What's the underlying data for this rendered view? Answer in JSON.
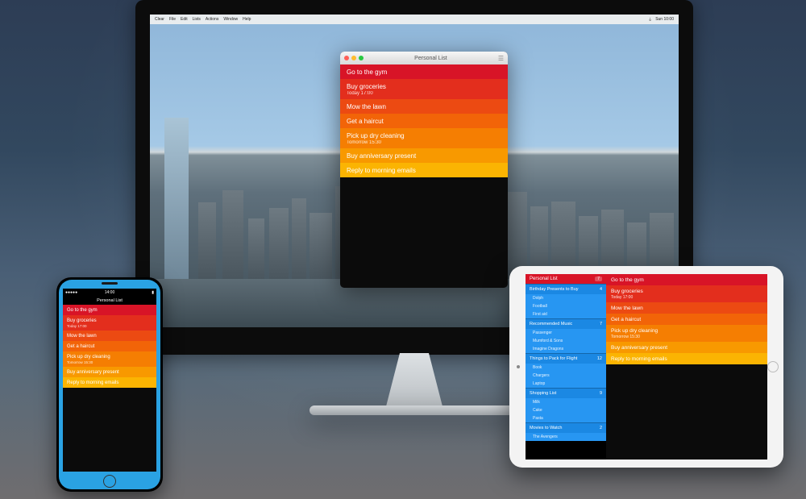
{
  "menubar": {
    "items": [
      "Clear",
      "File",
      "Edit",
      "Lists",
      "Actions",
      "Window",
      "Help"
    ],
    "clock": "Sun 10:00"
  },
  "mac_window": {
    "title": "Personal List"
  },
  "tasks": [
    {
      "title": "Go to the gym",
      "sub": ""
    },
    {
      "title": "Buy groceries",
      "sub": "Today 17:00"
    },
    {
      "title": "Mow the lawn",
      "sub": ""
    },
    {
      "title": "Get a haircut",
      "sub": ""
    },
    {
      "title": "Pick up dry cleaning",
      "sub": "Tomorrow 15:30"
    },
    {
      "title": "Buy anniversary present",
      "sub": ""
    },
    {
      "title": "Reply to morning emails",
      "sub": ""
    }
  ],
  "iphone": {
    "status_left": "●●●●●",
    "status_time": "14:00",
    "status_right": "▮",
    "header": "Personal List"
  },
  "ipad": {
    "sidebar": [
      {
        "type": "head",
        "label": "Personal List",
        "count": "7"
      },
      {
        "type": "item",
        "label": "Birthday Presents to Buy",
        "count": "4"
      },
      {
        "type": "sub",
        "label": "Dolph"
      },
      {
        "type": "sub",
        "label": "Football"
      },
      {
        "type": "sub",
        "label": "First aid"
      },
      {
        "type": "item",
        "label": "Recommended Music",
        "count": "7"
      },
      {
        "type": "sub",
        "label": "Passenger"
      },
      {
        "type": "sub",
        "label": "Mumford & Sons"
      },
      {
        "type": "sub",
        "label": "Imagine Dragons"
      },
      {
        "type": "item",
        "label": "Things to Pack for Flight",
        "count": "12"
      },
      {
        "type": "sub",
        "label": "Book"
      },
      {
        "type": "sub",
        "label": "Chargers"
      },
      {
        "type": "sub",
        "label": "Laptop"
      },
      {
        "type": "item",
        "label": "Shopping List",
        "count": "9"
      },
      {
        "type": "sub",
        "label": "Milk"
      },
      {
        "type": "sub",
        "label": "Cake"
      },
      {
        "type": "sub",
        "label": "Pasta"
      },
      {
        "type": "item",
        "label": "Movies to Watch",
        "count": "2"
      },
      {
        "type": "sub",
        "label": "The Avengers"
      }
    ]
  }
}
